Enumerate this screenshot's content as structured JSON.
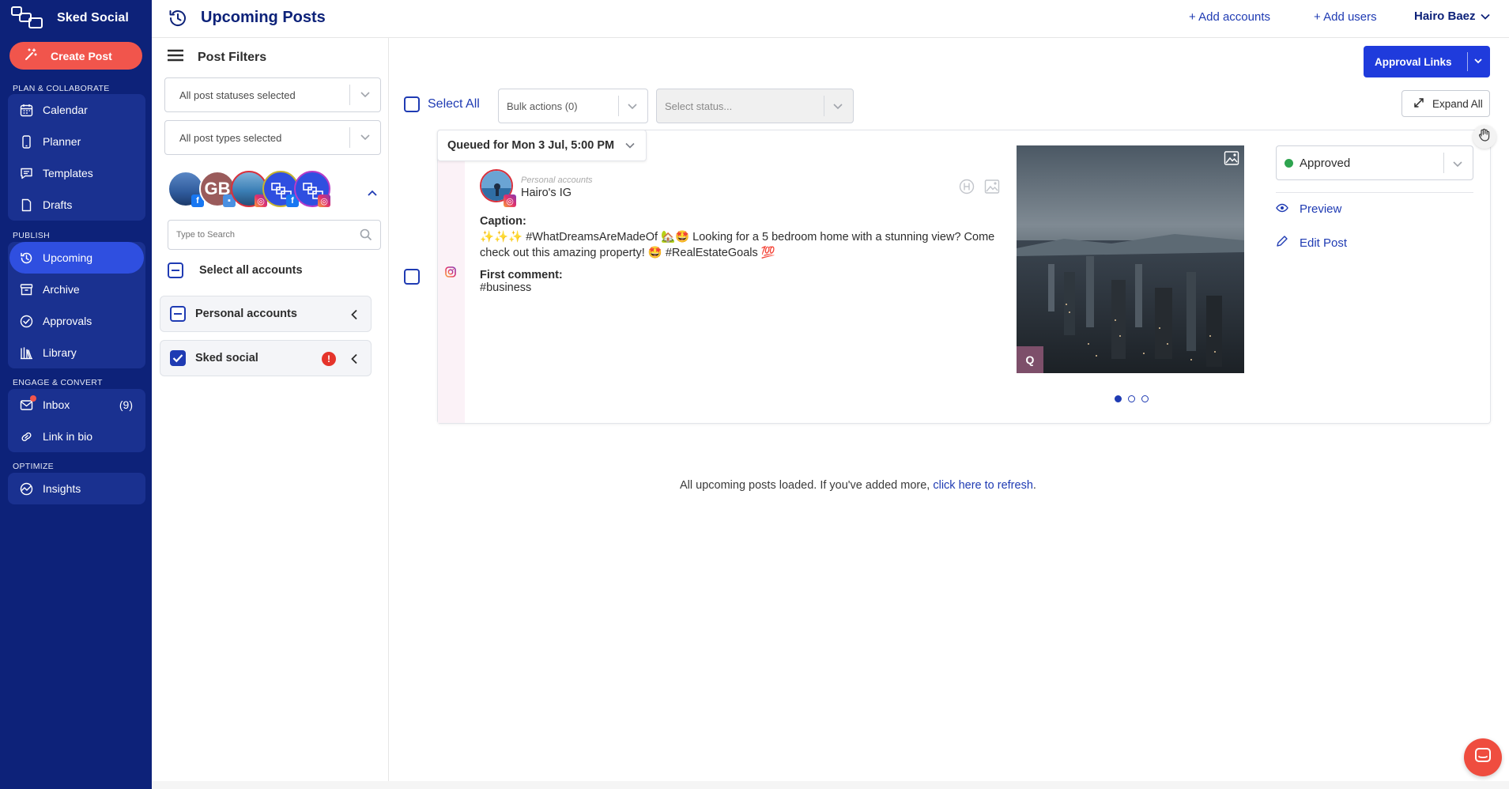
{
  "brand": {
    "name": "Sked Social"
  },
  "sidebar": {
    "create_post": "Create Post",
    "sections": [
      {
        "label": "PLAN & COLLABORATE",
        "items": [
          {
            "label": "Calendar",
            "icon": "calendar-icon"
          },
          {
            "label": "Planner",
            "icon": "phone-icon"
          },
          {
            "label": "Templates",
            "icon": "templates-icon"
          },
          {
            "label": "Drafts",
            "icon": "drafts-icon"
          }
        ]
      },
      {
        "label": "PUBLISH",
        "items": [
          {
            "label": "Upcoming",
            "icon": "history-icon",
            "active": true
          },
          {
            "label": "Archive",
            "icon": "archive-icon"
          },
          {
            "label": "Approvals",
            "icon": "check-circle-icon"
          },
          {
            "label": "Library",
            "icon": "library-icon"
          }
        ]
      },
      {
        "label": "ENGAGE & CONVERT",
        "items": [
          {
            "label": "Inbox",
            "icon": "inbox-icon",
            "count": "(9)"
          },
          {
            "label": "Link in bio",
            "icon": "link-icon"
          }
        ]
      },
      {
        "label": "OPTIMIZE",
        "items": [
          {
            "label": "Insights",
            "icon": "insights-icon"
          }
        ]
      }
    ]
  },
  "header": {
    "title": "Upcoming Posts",
    "add_accounts": "+ Add accounts",
    "add_users": "+ Add users",
    "user": "Hairo Baez"
  },
  "filters": {
    "title": "Post Filters",
    "statuses": "All post statuses selected",
    "types": "All post types selected",
    "search_placeholder": "Type to Search",
    "select_all_accounts": "Select all accounts",
    "groups": [
      {
        "label": "Personal accounts",
        "state": "partial"
      },
      {
        "label": "Sked social",
        "state": "checked",
        "warning": "!"
      }
    ],
    "avatar_initials": "GB"
  },
  "toolbar": {
    "approval_links": "Approval Links",
    "expand_all": "Expand All",
    "select_all": "Select All",
    "bulk_actions": "Bulk actions (0)",
    "select_status": "Select status..."
  },
  "post": {
    "queued": "Queued for Mon 3 Jul, 5:00 PM",
    "account_kind": "Personal accounts",
    "account_name": "Hairo's IG",
    "caption_label": "Caption:",
    "caption": "✨✨✨ #WhatDreamsAreMadeOf 🏡🤩 Looking for a 5 bedroom home with a stunning view? Come check out this amazing property! 🤩 #RealEstateGoals 💯",
    "first_comment_label": "First comment:",
    "first_comment": "#business",
    "image_badge": "Q",
    "status": "Approved",
    "preview": "Preview",
    "edit": "Edit Post"
  },
  "footer": {
    "loaded_text": "All upcoming posts loaded. If you've added more, ",
    "refresh_link": "click here to refresh",
    "period": "."
  },
  "colors": {
    "sidebar_bg": "#0d2279",
    "accent": "#1f3bdc",
    "create_btn": "#f1554c",
    "approved": "#2ea44f"
  }
}
